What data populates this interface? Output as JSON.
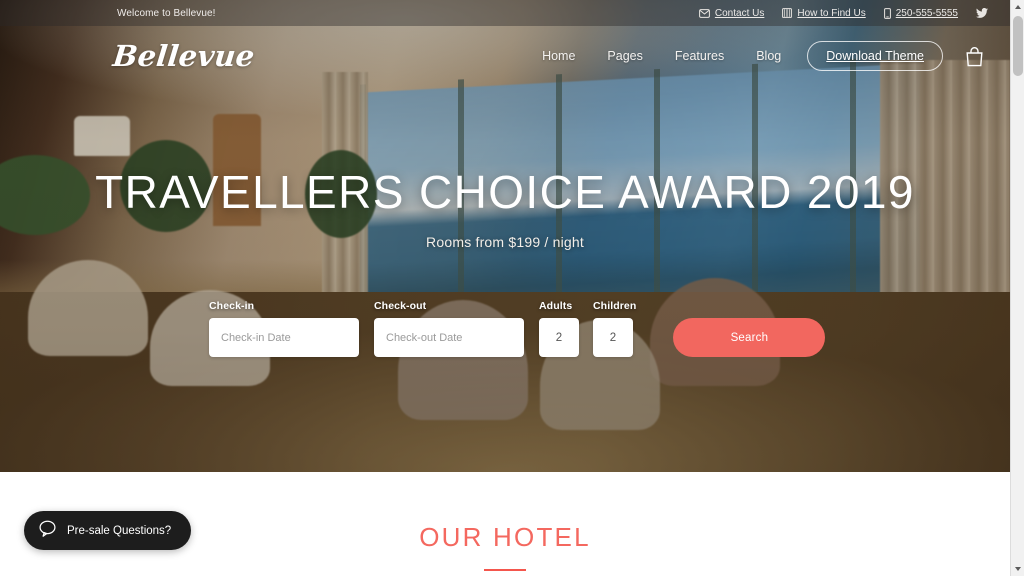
{
  "topbar": {
    "welcome": "Welcome to Bellevue!",
    "links": [
      {
        "label": "Contact Us",
        "icon": "envelope-icon"
      },
      {
        "label": "How to Find Us",
        "icon": "map-book-icon"
      },
      {
        "label": "250-555-5555",
        "icon": "phone-icon"
      }
    ],
    "social": {
      "label": "",
      "icon": "twitter-icon"
    }
  },
  "header": {
    "brand": "Bellevue",
    "nav": [
      {
        "label": "Home"
      },
      {
        "label": "Pages"
      },
      {
        "label": "Features"
      },
      {
        "label": "Blog"
      }
    ],
    "cta_label": "Download Theme",
    "cart_icon": "shopping-bag-icon"
  },
  "hero": {
    "title": "TRAVELLERS CHOICE AWARD 2019",
    "subtitle": "Rooms from $199 / night"
  },
  "booking": {
    "checkin_label": "Check-in",
    "checkin_placeholder": "Check-in Date",
    "checkin_value": "",
    "checkout_label": "Check-out",
    "checkout_placeholder": "Check-out Date",
    "checkout_value": "",
    "adults_label": "Adults",
    "adults_value": "2",
    "children_label": "Children",
    "children_value": "2",
    "search_label": "Search"
  },
  "section": {
    "title": "OUR HOTEL"
  },
  "widget": {
    "presale_label": "Pre-sale Questions?",
    "presale_icon": "chat-bubble-icon"
  },
  "colors": {
    "accent": "#f4685f",
    "accent_rule": "#f4564d",
    "search_button": "#f2675f",
    "widget_bg": "#1d1d1d"
  }
}
